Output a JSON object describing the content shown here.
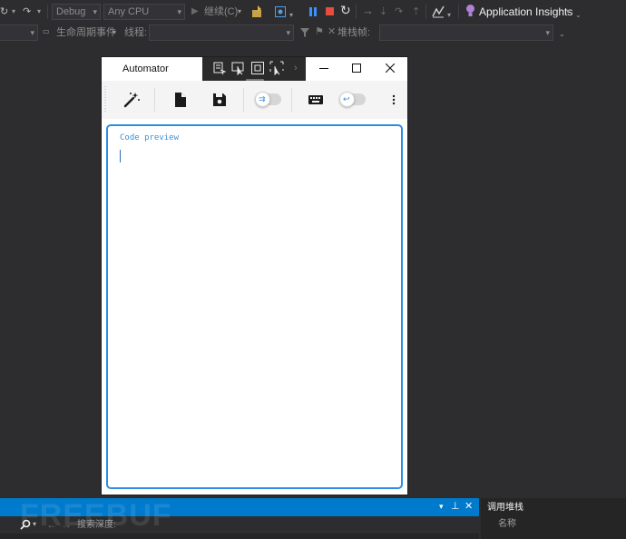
{
  "vs_toolbar": {
    "config_combo": "Debug",
    "platform_combo": "Any CPU",
    "continue_label": "继续(C)",
    "insights_label": "Application Insights",
    "lifecycle_label": "生命周期事件",
    "thread_label": "线程:",
    "stackframe_label": "堆栈帧:"
  },
  "automator": {
    "title": "Automator",
    "code_preview_label": "Code preview"
  },
  "bottom_panel": {
    "search_label": "搜索深度:",
    "callstack_title": "调用堆栈",
    "callstack_name_header": "名称"
  },
  "watermark": "FREEBUF",
  "colors": {
    "accent": "#007acc",
    "preview_border": "#2c8ce6",
    "pause": "#3794ff",
    "stop": "#e74c3c",
    "insights": "#b180d7"
  },
  "icons": {
    "wizard": "magic-wand-icon",
    "new_file": "file-icon",
    "save": "floppy-icon",
    "keyboard": "keyboard-icon",
    "more": "kebab-menu-icon"
  }
}
